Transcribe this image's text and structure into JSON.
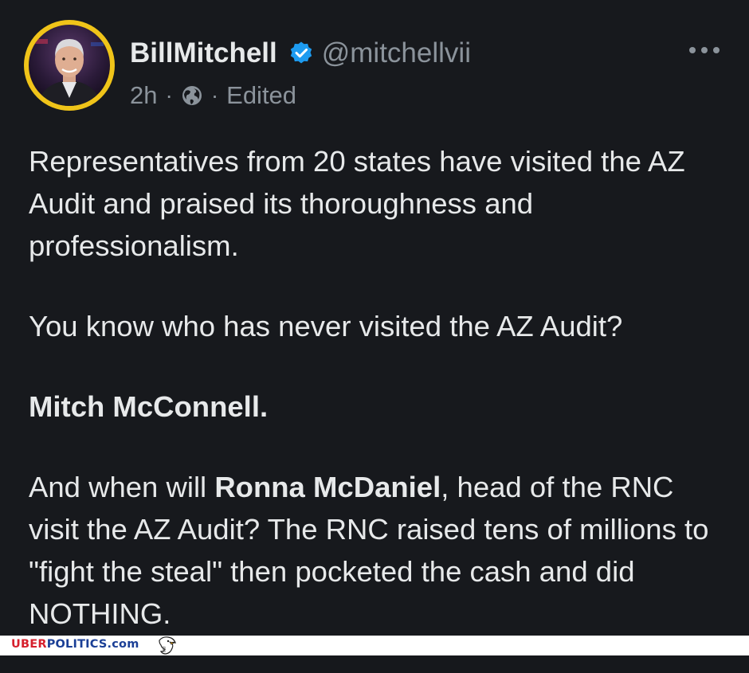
{
  "post": {
    "display_name": "BillMitchell",
    "handle": "@mitchellvii",
    "time": "2h",
    "separator": "·",
    "edited_label": "Edited",
    "verified_icon": "verified-badge-icon",
    "more_icon": "more-options-icon",
    "visibility_icon": "globe-icon",
    "paragraphs": [
      "Representatives from 20 states have visited the AZ Audit and praised its thoroughness and professionalism.",
      "You know who has never visited the AZ Audit?",
      "Mitch McConnell."
    ],
    "last_paragraph": {
      "prefix": "And when will ",
      "bold": "Ronna McDaniel",
      "suffix": ", head of the RNC visit the AZ Audit? The RNC raised tens of millions to \"fight the steal\" then pocketed the cash and did NOTHING."
    }
  },
  "footer": {
    "brand_part1": "UBER",
    "brand_part2": "POLITICS",
    "brand_part3": ".com",
    "mascot_icon": "eagle-icon"
  },
  "colors": {
    "background": "#16181c",
    "text": "#e7e9ea",
    "muted": "#8b939b",
    "verified": "#1d9bf0",
    "avatar_ring": "#f0c419",
    "brand_red": "#d6202d",
    "brand_blue": "#1b3f96"
  }
}
